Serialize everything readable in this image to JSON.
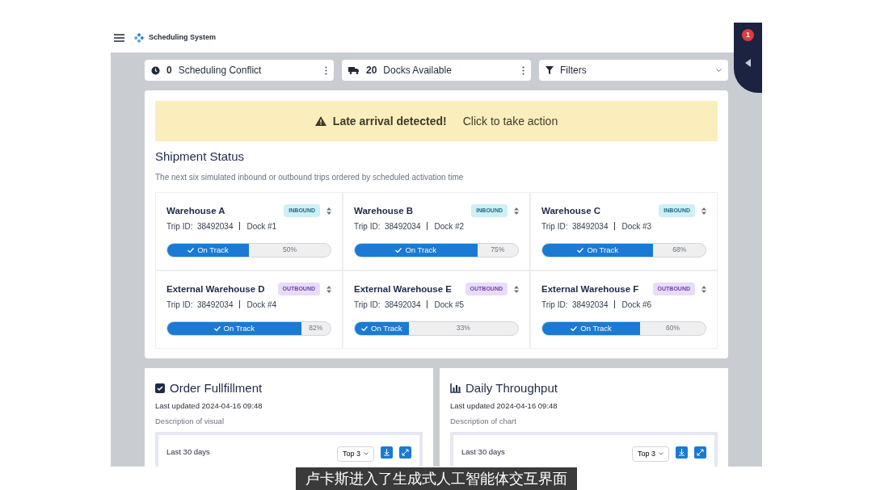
{
  "header": {
    "title": "Scheduling System"
  },
  "side_panel": {
    "badge": "1"
  },
  "summary": [
    {
      "kind": "conflict",
      "count": "0",
      "label": "Scheduling Conflict"
    },
    {
      "kind": "docks",
      "count": "20",
      "label": "Docks Available"
    },
    {
      "kind": "filter",
      "label": "Filters"
    }
  ],
  "alert": {
    "title": "Late arrival detected!",
    "action": "Click to take action"
  },
  "shipments": {
    "title": "Shipment Status",
    "description": "The next six simulated inbound or outbound trips ordered by scheduled activation time",
    "items": [
      {
        "name": "Warehouse A",
        "direction": "INBOUND",
        "trip": "Trip ID:  38492034",
        "dock": "Dock #1",
        "status": "On Track",
        "level": 0.5,
        "percent": "50%"
      },
      {
        "name": "Warehouse B",
        "direction": "INBOUND",
        "trip": "Trip ID:  38492034",
        "dock": "Dock #2",
        "status": "On Track",
        "level": 0.75,
        "percent": "75%"
      },
      {
        "name": "Warehouse C",
        "direction": "INBOUND",
        "trip": "Trip ID:  38492034",
        "dock": "Dock #3",
        "status": "On Track",
        "level": 0.68,
        "percent": "68%"
      },
      {
        "name": "External Warehouse D",
        "direction": "OUTBOUND",
        "trip": "Trip ID:  38492034",
        "dock": "Dock #4",
        "status": "On Track",
        "level": 0.82,
        "percent": "82%"
      },
      {
        "name": "External Warehouse E",
        "direction": "OUTBOUND",
        "trip": "Trip ID:  38492034",
        "dock": "Dock #5",
        "status": "On Track",
        "level": 0.33,
        "percent": "33%"
      },
      {
        "name": "External Warehouse F",
        "direction": "OUTBOUND",
        "trip": "Trip ID:  38492034",
        "dock": "Dock #6",
        "status": "On Track",
        "level": 0.6,
        "percent": "60%"
      }
    ]
  },
  "panels": [
    {
      "kind": "checklist",
      "title": "Order Fullfillment",
      "updated": "Last updated 2024-04-16 09:48",
      "description": "Description of  visual",
      "range": "Last 30 days",
      "top": "Top 3"
    },
    {
      "kind": "bars",
      "title": "Daily Throughput",
      "updated": "Last updated 2024-04-16 09:48",
      "description": "Description of chart",
      "range": "Last 30 days",
      "top": "Top 3"
    }
  ],
  "caption": "卢卡斯进入了生成式人工智能体交互界面"
}
